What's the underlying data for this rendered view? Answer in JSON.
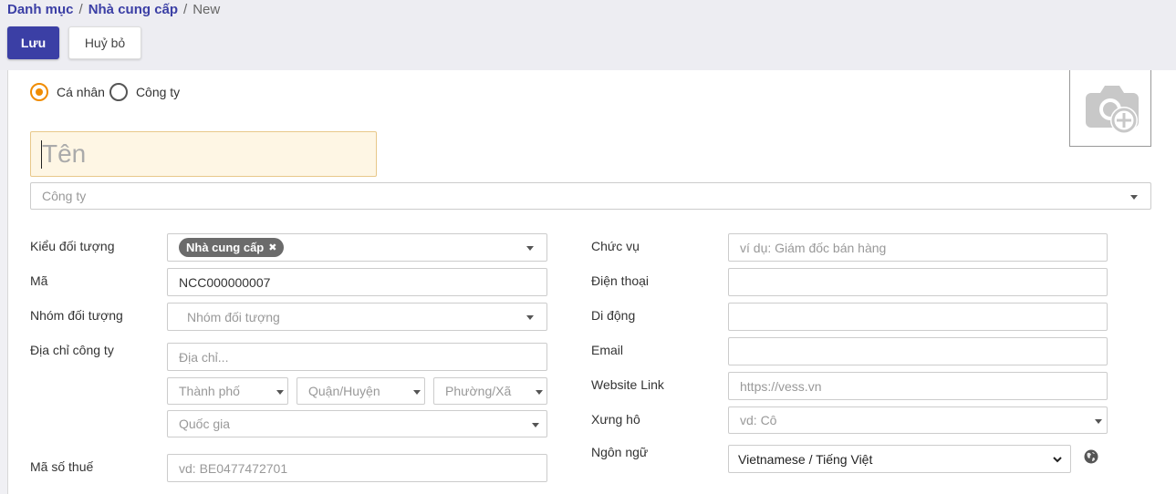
{
  "breadcrumb": {
    "root": "Danh mục",
    "parent": "Nhà cung cấp",
    "current": "New",
    "separator": "/"
  },
  "toolbar": {
    "save_label": "Lưu",
    "cancel_label": "Huỷ bỏ"
  },
  "company_type": {
    "options": [
      {
        "label": "Cá nhân",
        "checked": true
      },
      {
        "label": "Công ty",
        "checked": false
      }
    ]
  },
  "name": {
    "placeholder": "Tên"
  },
  "company": {
    "placeholder": "Công ty"
  },
  "left": {
    "partner_type": {
      "label": "Kiểu đối tượng",
      "tag": "Nhà cung cấp"
    },
    "code": {
      "label": "Mã",
      "value": "NCC000000007"
    },
    "group": {
      "label": "Nhóm đối tượng",
      "placeholder": "Nhóm đối tượng"
    },
    "address": {
      "label": "Địa chỉ công ty",
      "street_placeholder": "Địa chỉ...",
      "city_placeholder": "Thành phố",
      "district_placeholder": "Quận/Huyện",
      "ward_placeholder": "Phường/Xã",
      "country_placeholder": "Quốc gia"
    },
    "tax": {
      "label": "Mã số thuế",
      "placeholder": "vd: BE0477472701"
    }
  },
  "right": {
    "job": {
      "label": "Chức vụ",
      "placeholder": "ví dụ: Giám đốc bán hàng"
    },
    "phone": {
      "label": "Điện thoại"
    },
    "mobile": {
      "label": "Di động"
    },
    "email": {
      "label": "Email"
    },
    "website": {
      "label": "Website Link",
      "placeholder": "https://vess.vn"
    },
    "title": {
      "label": "Xưng hô",
      "placeholder": "vd: Cô"
    },
    "lang": {
      "label": "Ngôn ngữ",
      "value": "Vietnamese / Tiếng Việt"
    }
  },
  "icons": {
    "avatar": "camera-plus-icon",
    "globe": "globe-icon",
    "remove_tag": "close-icon"
  },
  "colors": {
    "primary": "#3b3fa5",
    "radio_accent": "#f08c00",
    "name_bg": "#fef6e4"
  }
}
